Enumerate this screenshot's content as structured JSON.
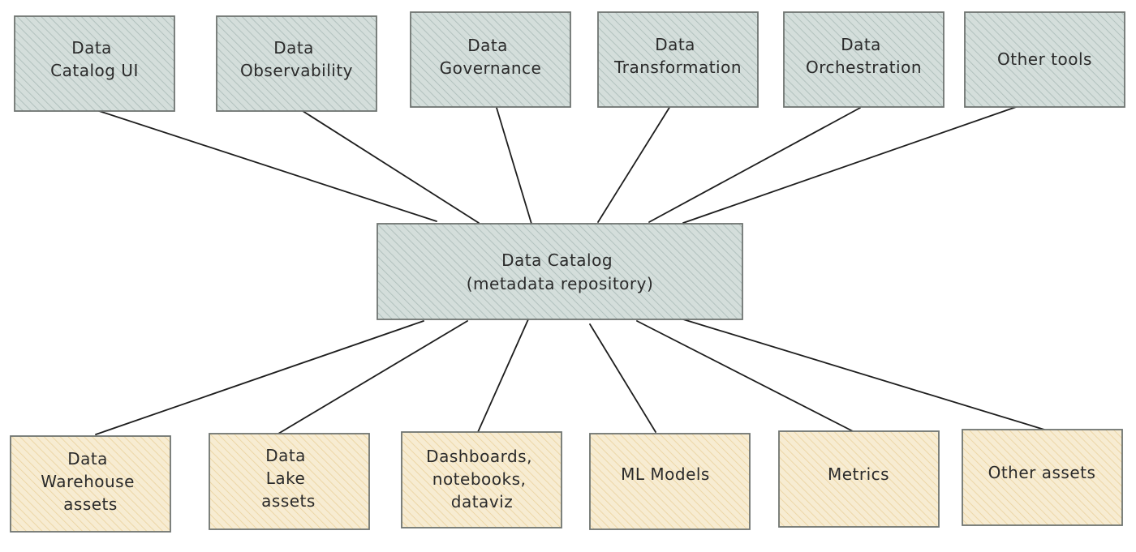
{
  "colors": {
    "tool_fill": "#d4dedb",
    "tool_hatch": "#a9bab6",
    "catalog_fill": "#d4dedb",
    "catalog_hatch": "#a9bab6",
    "asset_fill": "#f7ecd2",
    "asset_hatch": "#ead19c",
    "border": "#6f7471",
    "line": "#1e1e1e"
  },
  "center": {
    "lines": [
      "Data Catalog",
      "(metadata repository)"
    ]
  },
  "tools": [
    {
      "id": "catalog-ui",
      "lines": [
        "Data",
        "Catalog UI"
      ]
    },
    {
      "id": "observability",
      "lines": [
        "Data",
        "Observability"
      ]
    },
    {
      "id": "governance",
      "lines": [
        "Data",
        "Governance"
      ]
    },
    {
      "id": "transformation",
      "lines": [
        "Data",
        "Transformation"
      ]
    },
    {
      "id": "orchestration",
      "lines": [
        "Data",
        "Orchestration"
      ]
    },
    {
      "id": "other-tools",
      "lines": [
        "Other tools"
      ]
    }
  ],
  "assets": [
    {
      "id": "warehouse-assets",
      "lines": [
        "Data",
        "Warehouse",
        "assets"
      ]
    },
    {
      "id": "lake-assets",
      "lines": [
        "Data",
        "Lake",
        "assets"
      ]
    },
    {
      "id": "dashboards",
      "lines": [
        "Dashboards,",
        "notebooks,",
        "dataviz"
      ]
    },
    {
      "id": "ml-models",
      "lines": [
        "ML Models"
      ]
    },
    {
      "id": "metrics",
      "lines": [
        "Metrics"
      ]
    },
    {
      "id": "other-assets",
      "lines": [
        "Other assets"
      ]
    }
  ]
}
